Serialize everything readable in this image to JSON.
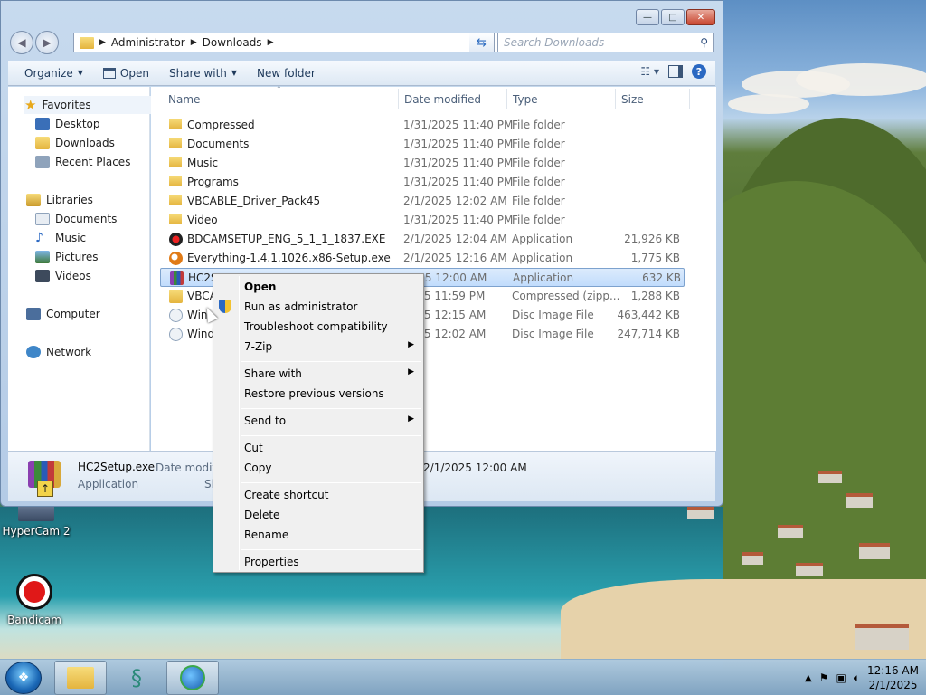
{
  "window": {
    "caption": {
      "minimize": "—",
      "maximize": "□",
      "close": "✕"
    },
    "breadcrumb": [
      "Administrator",
      "Downloads"
    ],
    "search_placeholder": "Search Downloads",
    "toolbar": {
      "organize": "Organize",
      "open": "Open",
      "share_with": "Share with",
      "new_folder": "New folder"
    },
    "nav": {
      "favorites": "Favorites",
      "favorites_items": [
        "Desktop",
        "Downloads",
        "Recent Places"
      ],
      "libraries": "Libraries",
      "libraries_items": [
        "Documents",
        "Music",
        "Pictures",
        "Videos"
      ],
      "computer": "Computer",
      "network": "Network"
    },
    "columns": {
      "name": "Name",
      "date": "Date modified",
      "type": "Type",
      "size": "Size"
    },
    "files": [
      {
        "name": "Compressed",
        "date": "1/31/2025 11:40 PM",
        "type": "File folder",
        "size": "",
        "kind": "folder"
      },
      {
        "name": "Documents",
        "date": "1/31/2025 11:40 PM",
        "type": "File folder",
        "size": "",
        "kind": "folder"
      },
      {
        "name": "Music",
        "date": "1/31/2025 11:40 PM",
        "type": "File folder",
        "size": "",
        "kind": "folder"
      },
      {
        "name": "Programs",
        "date": "1/31/2025 11:40 PM",
        "type": "File folder",
        "size": "",
        "kind": "folder"
      },
      {
        "name": "VBCABLE_Driver_Pack45",
        "date": "2/1/2025 12:02 AM",
        "type": "File folder",
        "size": "",
        "kind": "folder"
      },
      {
        "name": "Video",
        "date": "1/31/2025 11:40 PM",
        "type": "File folder",
        "size": "",
        "kind": "folder"
      },
      {
        "name": "BDCAMSETUP_ENG_5_1_1_1837.EXE",
        "date": "2/1/2025 12:04 AM",
        "type": "Application",
        "size": "21,926 KB",
        "kind": "bdcam"
      },
      {
        "name": "Everything-1.4.1.1026.x86-Setup.exe",
        "date": "2/1/2025 12:16 AM",
        "type": "Application",
        "size": "1,775 KB",
        "kind": "everything"
      },
      {
        "name": "HC2S",
        "date": "2025 12:00 AM",
        "type": "Application",
        "size": "632 KB",
        "kind": "hc2"
      },
      {
        "name": "VBCA",
        "date": "2025 11:59 PM",
        "type": "Compressed (zipp...",
        "size": "1,288 KB",
        "kind": "zip"
      },
      {
        "name": "Win",
        "date": "2025 12:15 AM",
        "type": "Disc Image File",
        "size": "463,442 KB",
        "kind": "iso"
      },
      {
        "name": "Wind",
        "date": "2025 12:02 AM",
        "type": "Disc Image File",
        "size": "247,714 KB",
        "kind": "iso"
      }
    ],
    "details": {
      "filename": "HC2Setup.exe",
      "date_label": "Date modifi",
      "date_value": "2/1/2025 12:00 AM",
      "type": "Application",
      "size_label": "Si"
    }
  },
  "context_menu": {
    "open": "Open",
    "run_admin": "Run as administrator",
    "troubleshoot": "Troubleshoot compatibility",
    "zip": "7-Zip",
    "share_with": "Share with",
    "restore": "Restore previous versions",
    "send_to": "Send to",
    "cut": "Cut",
    "copy": "Copy",
    "create_shortcut": "Create shortcut",
    "delete": "Delete",
    "rename": "Rename",
    "properties": "Properties"
  },
  "desktop_icons": [
    "HyperCam 2",
    "Bandicam"
  ],
  "taskbar": {
    "time": "12:16 AM",
    "date": "2/1/2025"
  },
  "colors": {
    "selection": "#cce4fc",
    "accent": "#1e395b",
    "close_red": "#c8452f"
  }
}
